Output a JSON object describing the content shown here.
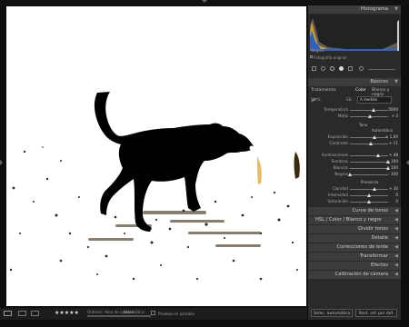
{
  "panels": {
    "histogram": "Histograma",
    "basic": "Básicos",
    "tone_curve": "Curva de tonos",
    "hsl_tabs": [
      "HSL",
      "/",
      "Color",
      "/",
      "Blanco y negro"
    ],
    "split_toning": "Dividir tonos",
    "detail": "Detalle",
    "lens": "Correcciones de lente",
    "transform": "Transformar",
    "effects": "Efectos",
    "calibration": "Calibración de cámara"
  },
  "histogram_info": {
    "left": "Negros",
    "right": "",
    "original": "Fotografía original"
  },
  "basic": {
    "treatment_label": "Tratamiento:",
    "treatment_options": [
      "Color",
      "Blanco y negro"
    ],
    "profile_label": "Perfil:",
    "wb_label": "EB:",
    "wb_value": "A medida",
    "tone_label": "Tono",
    "auto_label": "Automático",
    "presence_label": "Presencia"
  },
  "sliders_wb": [
    {
      "label": "Temperatura",
      "value": "5600",
      "pos": 0.62
    },
    {
      "label": "Matiz",
      "value": "+ 2",
      "pos": 0.52
    }
  ],
  "sliders_tone": [
    {
      "label": "Exposición",
      "value": "+ 1,00",
      "pos": 0.65
    },
    {
      "label": "Contraste",
      "value": "+ 11",
      "pos": 0.55
    }
  ],
  "sliders_tone2": [
    {
      "label": "Iluminaciones",
      "value": "+ 48",
      "pos": 0.74
    },
    {
      "label": "Sombras",
      "value": "+ 100",
      "pos": 0.99
    },
    {
      "label": "Blancos",
      "value": "+ 100",
      "pos": 0.99
    },
    {
      "label": "Negros",
      "value": "- 100",
      "pos": 0.01
    }
  ],
  "sliders_presence": [
    {
      "label": "Claridad",
      "value": "+ 30",
      "pos": 0.65
    },
    {
      "label": "Intensidad",
      "value": "0",
      "pos": 0.5
    },
    {
      "label": "Saturación",
      "value": "0",
      "pos": 0.5
    }
  ],
  "bottom": {
    "soft_proof": "Pruebas en pantalla",
    "stars": "★★★★★",
    "sort_label": "Ordenar: Hora de captura",
    "sort_value": "Automático"
  },
  "buttons": {
    "previous": "Selec. automática",
    "reset": "Rest. ref. por def."
  },
  "colors": {
    "panel": "#2a2a2a",
    "header": "#3c3c3c",
    "canvas": "#ffffff"
  }
}
